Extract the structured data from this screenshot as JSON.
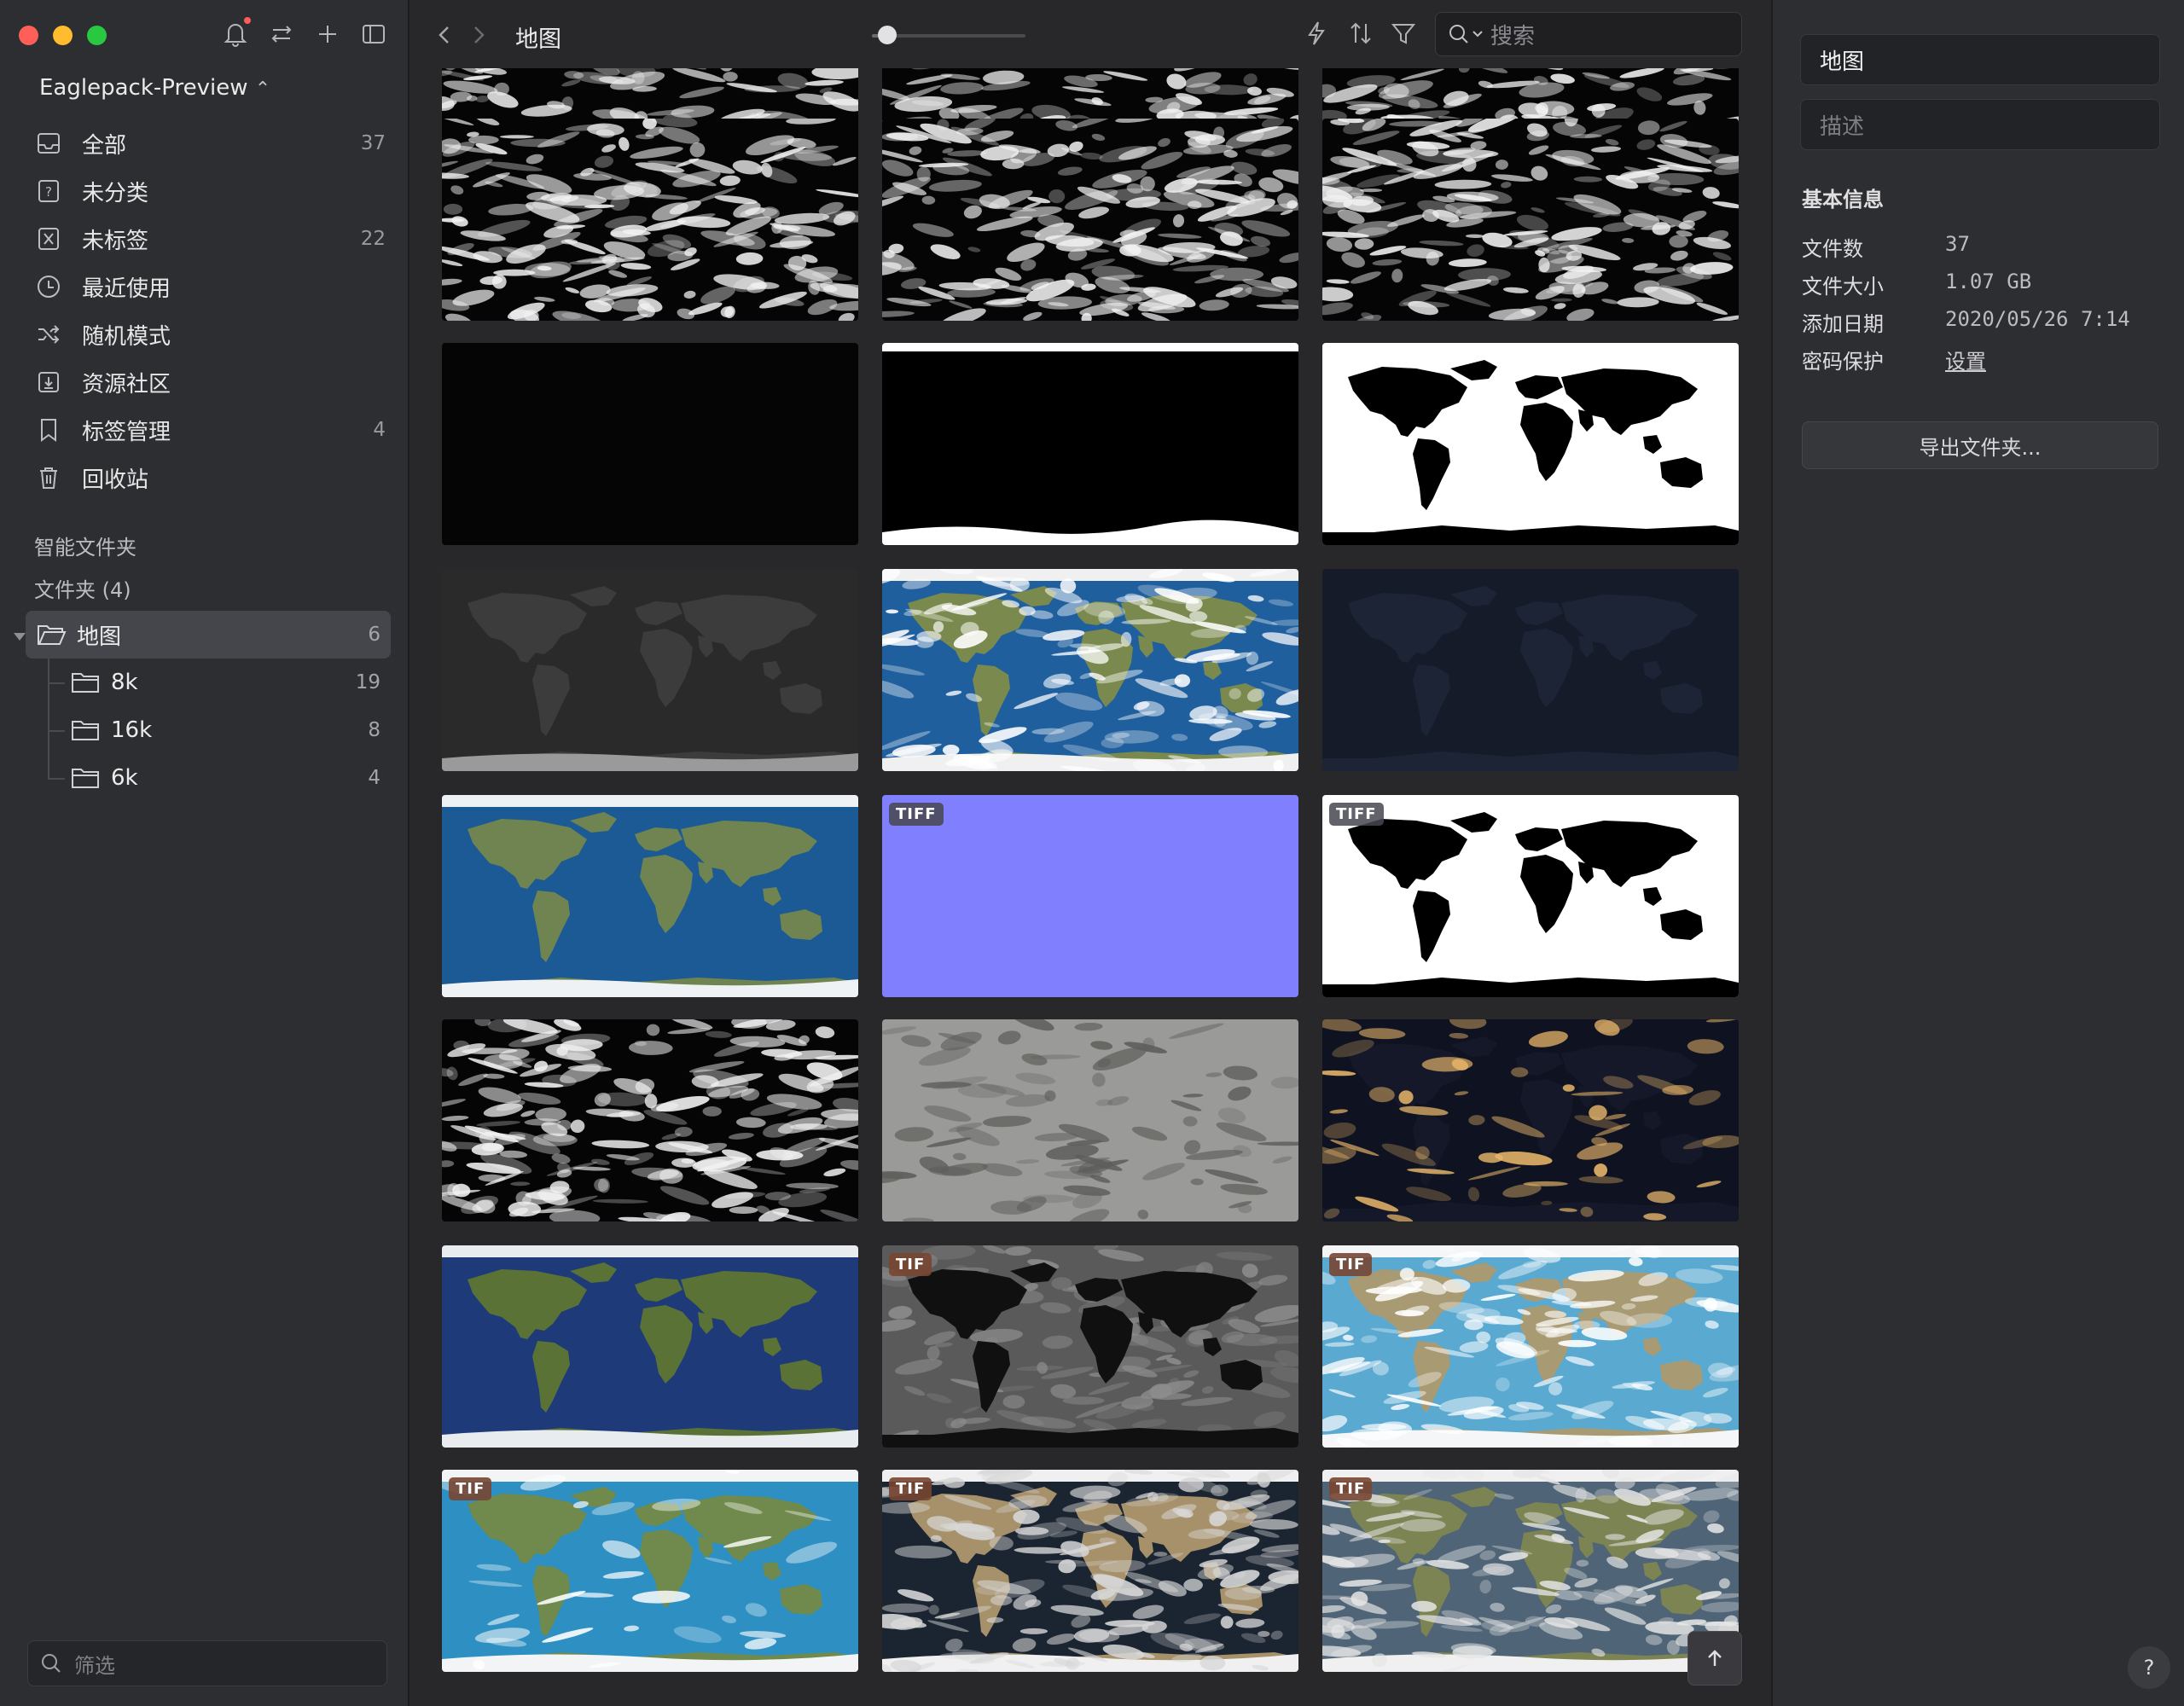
{
  "sidebar": {
    "library_name": "Eaglepack-Preview",
    "nav": [
      {
        "label": "全部",
        "count": "37"
      },
      {
        "label": "未分类",
        "count": ""
      },
      {
        "label": "未标签",
        "count": "22"
      },
      {
        "label": "最近使用",
        "count": ""
      },
      {
        "label": "随机模式",
        "count": ""
      },
      {
        "label": "资源社区",
        "count": ""
      },
      {
        "label": "标签管理",
        "count": "4"
      },
      {
        "label": "回收站",
        "count": ""
      }
    ],
    "smart_folders_label": "智能文件夹",
    "folders_label": "文件夹 (4)",
    "folders": [
      {
        "label": "地图",
        "count": "6"
      },
      {
        "label": "8k",
        "count": "19"
      },
      {
        "label": "16k",
        "count": "8"
      },
      {
        "label": "6k",
        "count": "4"
      }
    ],
    "filter_placeholder": "筛选"
  },
  "toolbar": {
    "title": "地图",
    "search_placeholder": "搜索",
    "zoom_level": 0.1
  },
  "thumbnails": [
    {
      "kind": "clouds-strip",
      "badge": ""
    },
    {
      "kind": "clouds-strip",
      "badge": ""
    },
    {
      "kind": "clouds-strip",
      "badge": ""
    },
    {
      "kind": "clouds",
      "badge": ""
    },
    {
      "kind": "clouds",
      "badge": ""
    },
    {
      "kind": "clouds",
      "badge": ""
    },
    {
      "kind": "black",
      "badge": ""
    },
    {
      "kind": "ocean-mask-black",
      "badge": ""
    },
    {
      "kind": "land-mask",
      "badge": ""
    },
    {
      "kind": "topo-gray",
      "badge": ""
    },
    {
      "kind": "earth-clouds",
      "badge": ""
    },
    {
      "kind": "night-blue",
      "badge": ""
    },
    {
      "kind": "earth-blue",
      "badge": ""
    },
    {
      "kind": "normal-map",
      "badge": "TIFF"
    },
    {
      "kind": "land-mask",
      "badge": "TIFF"
    },
    {
      "kind": "clouds",
      "badge": ""
    },
    {
      "kind": "moon",
      "badge": ""
    },
    {
      "kind": "night-lights",
      "badge": ""
    },
    {
      "kind": "earth-navy",
      "badge": ""
    },
    {
      "kind": "gray-landblack",
      "badge": "TIF"
    },
    {
      "kind": "earth-lightblue",
      "badge": "TIF"
    },
    {
      "kind": "earth-bathy",
      "badge": "TIF"
    },
    {
      "kind": "earth-dark-clouds",
      "badge": "TIF"
    },
    {
      "kind": "earth-gray-clouds",
      "badge": "TIF"
    }
  ],
  "inspector": {
    "name_value": "地图",
    "description_placeholder": "描述",
    "section_title": "基本信息",
    "rows": [
      {
        "key": "文件数",
        "value": "37"
      },
      {
        "key": "文件大小",
        "value": "1.07 GB"
      },
      {
        "key": "添加日期",
        "value": "2020/05/26 7:14"
      },
      {
        "key": "密码保护",
        "value": "设置"
      }
    ],
    "export_label": "导出文件夹...",
    "help_label": "?"
  }
}
